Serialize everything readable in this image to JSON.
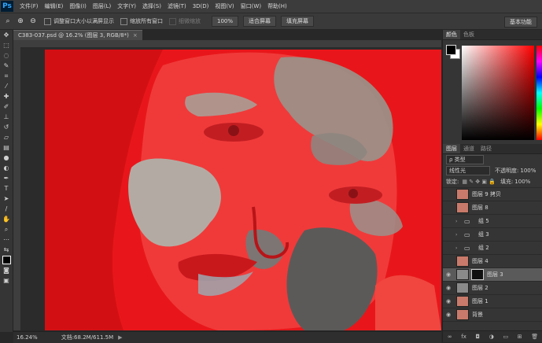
{
  "app": {
    "logo": "Ps"
  },
  "menu": [
    "文件(F)",
    "编辑(E)",
    "图像(I)",
    "图层(L)",
    "文字(Y)",
    "选择(S)",
    "滤镜(T)",
    "3D(D)",
    "视图(V)",
    "窗口(W)",
    "帮助(H)"
  ],
  "options": {
    "resize_windows_label": "调整窗口大小以满屏显示",
    "zoom_all_label": "缩放所有窗口",
    "scrubby_label": "细微缩放",
    "zoom_value": "100%",
    "fit_screen_label": "适合屏幕",
    "fill_screen_label": "填充屏幕",
    "workspace_label": "基本功能"
  },
  "document": {
    "tab_title": "C383-037.psd @ 16.2% (图层 3, RGB/8*)",
    "close": "×"
  },
  "status": {
    "zoom": "16.24%",
    "doc_info": "文档:68.2M/611.5M",
    "arrow": "▶"
  },
  "color_panel": {
    "tabs": [
      "颜色",
      "色板"
    ]
  },
  "layers_panel": {
    "tabs": [
      "图层",
      "通道",
      "路径"
    ],
    "filter_kind": "ρ 类型",
    "blend_mode": "线性光",
    "opacity_label": "不透明度:",
    "opacity_value": "100%",
    "lock_label": "锁定:",
    "fill_label": "填充:",
    "fill_value": "100%",
    "layers": [
      {
        "name": "图层 9 拷贝",
        "kind": "photo",
        "visible": false
      },
      {
        "name": "图层 8",
        "kind": "photo",
        "visible": false
      },
      {
        "name": "组 5",
        "kind": "group",
        "visible": false
      },
      {
        "name": "组 3",
        "kind": "group",
        "visible": false
      },
      {
        "name": "组 2",
        "kind": "group",
        "visible": false
      },
      {
        "name": "图层 4",
        "kind": "photo",
        "visible": false
      },
      {
        "name": "图层 3",
        "kind": "masked",
        "visible": true,
        "selected": true
      },
      {
        "name": "图层 2",
        "kind": "gray",
        "visible": true
      },
      {
        "name": "图层 1",
        "kind": "photo",
        "visible": true
      },
      {
        "name": "背景",
        "kind": "photo",
        "visible": true
      }
    ],
    "footer_icons": [
      "link-icon",
      "fx-icon",
      "mask-icon",
      "adjustment-icon",
      "group-icon",
      "new-layer-icon",
      "trash-icon"
    ]
  },
  "colors": {
    "overlay_red": "#e8161a",
    "panel_bg": "#353535"
  }
}
